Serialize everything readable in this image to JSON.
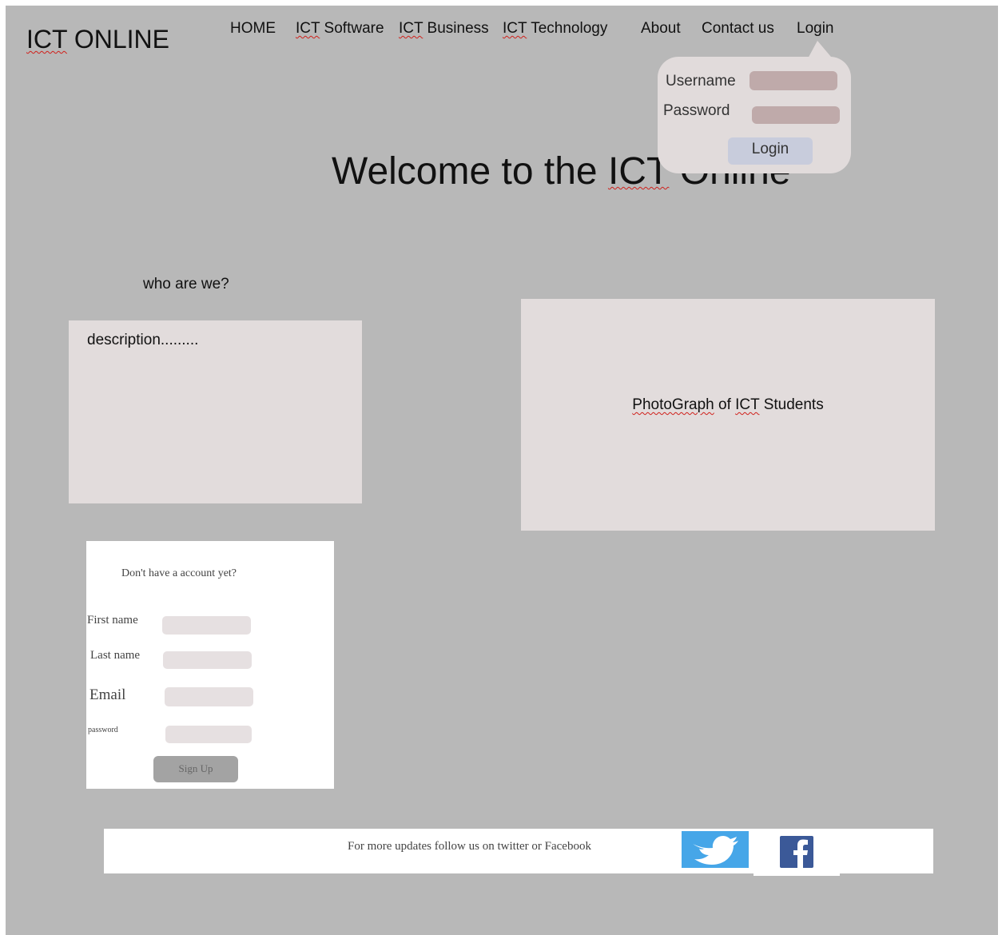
{
  "header": {
    "logo_prefix": "ICT",
    "logo_suffix": " ONLINE"
  },
  "nav": {
    "home": "HOME",
    "ict_software_prefix": "ICT",
    "ict_software_suffix": " Software",
    "ict_business_prefix": "ICT",
    "ict_business_suffix": " Business",
    "ict_technology_prefix": "ICT",
    "ict_technology_suffix": " Technology",
    "about": "About",
    "contact": "Contact us",
    "login": "Login"
  },
  "login_popup": {
    "username_label": "Username",
    "password_label": "Password",
    "username_value": "",
    "password_value": "",
    "button_label": "Login"
  },
  "welcome": {
    "prefix": "Welcome to the ",
    "ict": "ICT",
    "suffix": " Online"
  },
  "about": {
    "heading": "who are we?",
    "description": "description.........",
    "photo_prefix": "PhotoGraph",
    "photo_middle": " of ",
    "photo_ict": "ICT",
    "photo_suffix": " Students"
  },
  "signup": {
    "title": "Don't have a account yet?",
    "first_name_label": "First name",
    "last_name_label": "Last name",
    "email_label": "Email",
    "password_label": "password",
    "first_name_value": "",
    "last_name_value": "",
    "email_value": "",
    "password_value": "",
    "button_label": "Sign Up"
  },
  "footer": {
    "text": "For more updates follow us on twitter or Facebook",
    "twitter_icon": "twitter-bird-icon",
    "facebook_icon": "facebook-f-icon"
  },
  "colors": {
    "page_background": "#b8b8b8",
    "panel": "#e2dcdc",
    "twitter_blue": "#46a6e8",
    "facebook_blue": "#3b5998"
  }
}
